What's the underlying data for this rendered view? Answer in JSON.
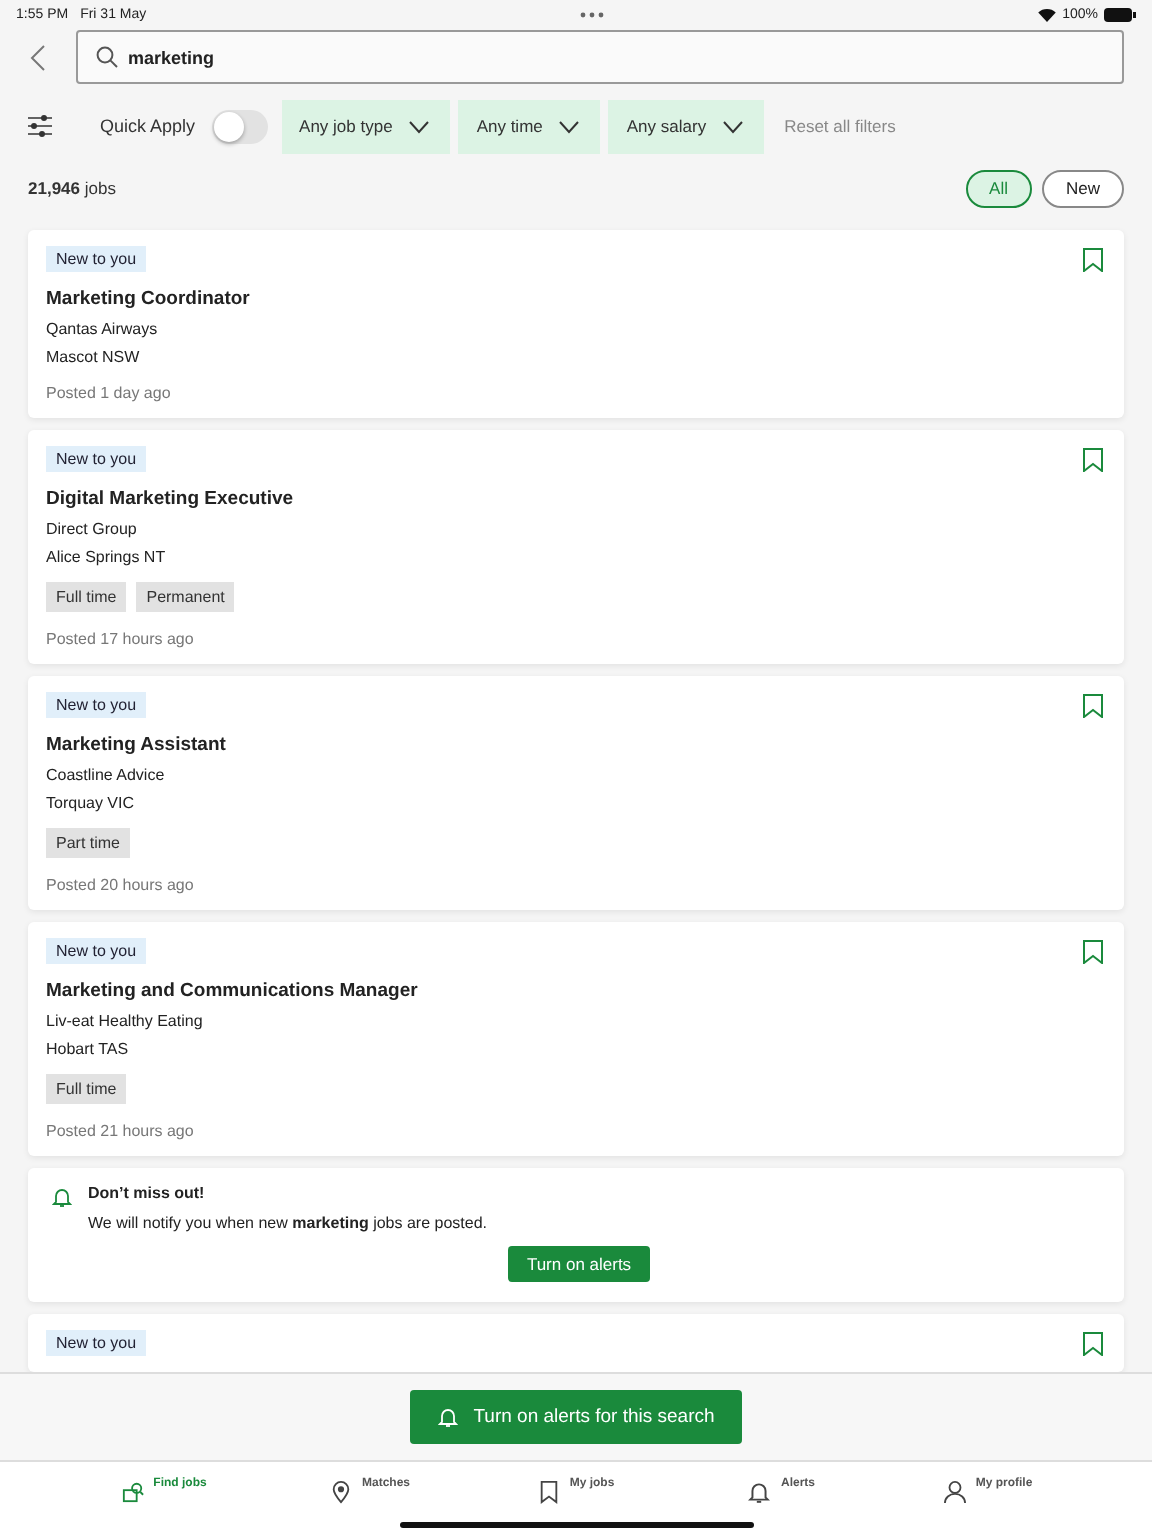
{
  "status_bar": {
    "time": "1:55 PM",
    "date": "Fri 31 May",
    "battery": "100%"
  },
  "search": {
    "value": "marketing"
  },
  "filters": {
    "quick_apply": {
      "label": "Quick Apply",
      "on": false
    },
    "dropdowns": [
      "Any job type",
      "Any time",
      "Any salary"
    ],
    "reset": "Reset all filters"
  },
  "results": {
    "count": "21,946",
    "unit": "jobs",
    "segments": [
      {
        "label": "All",
        "selected": true
      },
      {
        "label": "New",
        "selected": false
      }
    ]
  },
  "cards": [
    {
      "kind": "job",
      "badge": "New to you",
      "title": "Marketing Coordinator",
      "company": "Qantas Airways",
      "location": "Mascot NSW",
      "posted": "Posted 1 day ago",
      "saved": false
    },
    {
      "kind": "job",
      "badge": "New to you",
      "title": "Digital Marketing Executive",
      "company": "Direct Group",
      "location": "Alice Springs NT",
      "tags": [
        "Full time",
        "Permanent"
      ],
      "posted": "Posted 17 hours ago",
      "saved": false
    },
    {
      "kind": "job",
      "badge": "New to you",
      "title": "Marketing Assistant",
      "company": "Coastline Advice",
      "location": "Torquay VIC",
      "tags": [
        "Part time"
      ],
      "posted": "Posted 20 hours ago",
      "saved": false
    },
    {
      "kind": "job",
      "badge": "New to you",
      "title": "Marketing and Communications Manager",
      "company": "Liv-eat Healthy Eating",
      "location": "Hobart TAS",
      "tags": [
        "Full time"
      ],
      "posted": "Posted 21 hours ago",
      "saved": false
    },
    {
      "kind": "alert",
      "title": "Don’t miss out!",
      "text": "We will notify you when new **marketing** jobs are posted.",
      "button": "Turn on alerts"
    },
    {
      "kind": "job",
      "badge": "New to you",
      "saved": false
    }
  ],
  "alert_bar": {
    "button": "Turn on alerts for this search"
  },
  "tab_bar": [
    {
      "label": "Find jobs",
      "selected": true
    },
    {
      "label": "Matches",
      "selected": false
    },
    {
      "label": "My jobs",
      "selected": false
    },
    {
      "label": "Alerts",
      "selected": false
    },
    {
      "label": "My profile",
      "selected": false
    }
  ]
}
